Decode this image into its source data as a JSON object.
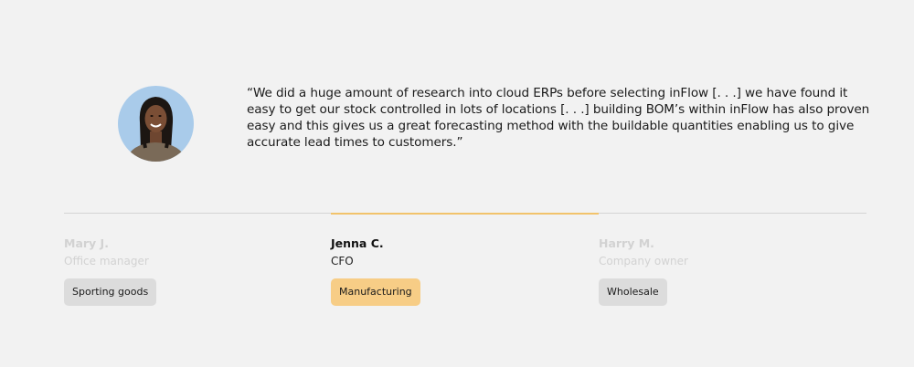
{
  "testimonial": {
    "quote": "“We did a huge amount of research into cloud ERPs before selecting inFlow [. . .] we have found it easy to get our stock controlled in lots of locations [. . .] building BOM’s within inFlow has also proven easy and this gives us a great forecasting method with the buildable quantities enabling us to give accurate lead times to customers.”"
  },
  "people": [
    {
      "name": "Mary J.",
      "role": "Office manager",
      "industry": "Sporting goods",
      "active": false
    },
    {
      "name": "Jenna C.",
      "role": "CFO",
      "industry": "Manufacturing",
      "active": true
    },
    {
      "name": "Harry M.",
      "role": "Company owner",
      "industry": "Wholesale",
      "active": false
    }
  ],
  "colors": {
    "background": "#f2f2f2",
    "accent": "#f2c36b",
    "active_tag": "#f7cd86",
    "inactive_tag": "#dcdcdc",
    "inactive_text": "#d2d2d2"
  }
}
